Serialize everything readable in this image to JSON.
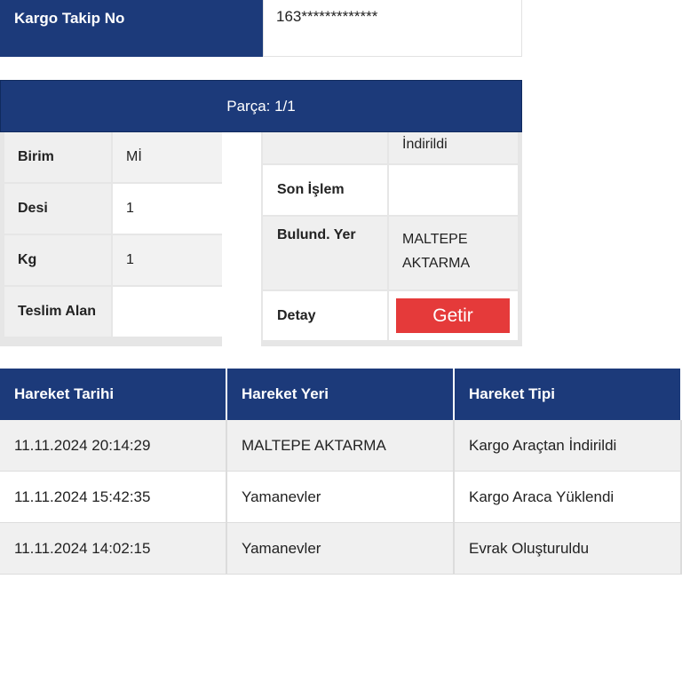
{
  "tracking": {
    "label": "Kargo Takip No",
    "value": "163*************"
  },
  "piece": {
    "header": "Parça: 1/1",
    "left_rows": [
      {
        "key": "Birim",
        "value": "Mİ"
      },
      {
        "key": "Desi",
        "value": "1"
      },
      {
        "key": "Kg",
        "value": "1"
      },
      {
        "key": "Teslim Alan",
        "value": ""
      }
    ],
    "right_rows": [
      {
        "key": "",
        "value": "İndirildi"
      },
      {
        "key": "Son İşlem",
        "value": ""
      },
      {
        "key": "Bulund. Yer",
        "value": "MALTEPE AKTARMA"
      },
      {
        "key": "Detay",
        "button": "Getir"
      }
    ]
  },
  "movements": {
    "headers": [
      "Hareket Tarihi",
      "Hareket Yeri",
      "Hareket Tipi"
    ],
    "rows": [
      [
        "11.11.2024 20:14:29",
        "MALTEPE AKTARMA",
        "Kargo Araçtan İndirildi"
      ],
      [
        "11.11.2024 15:42:35",
        "Yamanevler",
        "Kargo Araca Yüklendi"
      ],
      [
        "11.11.2024 14:02:15",
        "Yamanevler",
        "Evrak Oluşturuldu"
      ]
    ]
  },
  "colors": {
    "navy": "#1c3a7a",
    "button_red": "#e53a3a"
  }
}
